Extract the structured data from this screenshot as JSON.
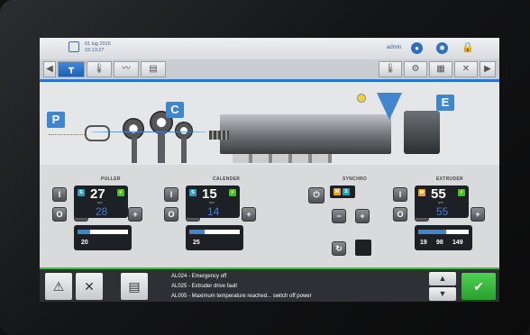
{
  "header": {
    "date": "01 lug 2015",
    "time": "15:13:27",
    "user": "admin"
  },
  "icons": [
    "calendar-icon",
    "user-icon",
    "gear-icon",
    "lock-icon"
  ],
  "colors": {
    "accent": "#2b74c9",
    "ok": "#35c23a"
  },
  "groups": {
    "puller": {
      "title": "PULLER",
      "actual": "27",
      "set": "28",
      "unit": "rpm",
      "gauge_value": "20",
      "badge": "S"
    },
    "calender": {
      "title": "CALENDER",
      "actual": "15",
      "set": "14",
      "unit": "rpm",
      "gauge_value": "25",
      "badge": "S"
    },
    "synchro": {
      "title": "SYNCHRO"
    },
    "extruder": {
      "title": "EXTRUDER",
      "actual": "55",
      "set": "55",
      "unit": "rpm",
      "gauge_values": [
        "19",
        "98",
        "149"
      ],
      "badge": "M"
    }
  },
  "machine_labels": {
    "p": "P",
    "c": "C",
    "e": "E"
  },
  "alarms": [
    "AL024 - Emergency off",
    "AL025 - Extruder drive fault",
    "AL005 - Maximum temperature reached... switch off power"
  ]
}
